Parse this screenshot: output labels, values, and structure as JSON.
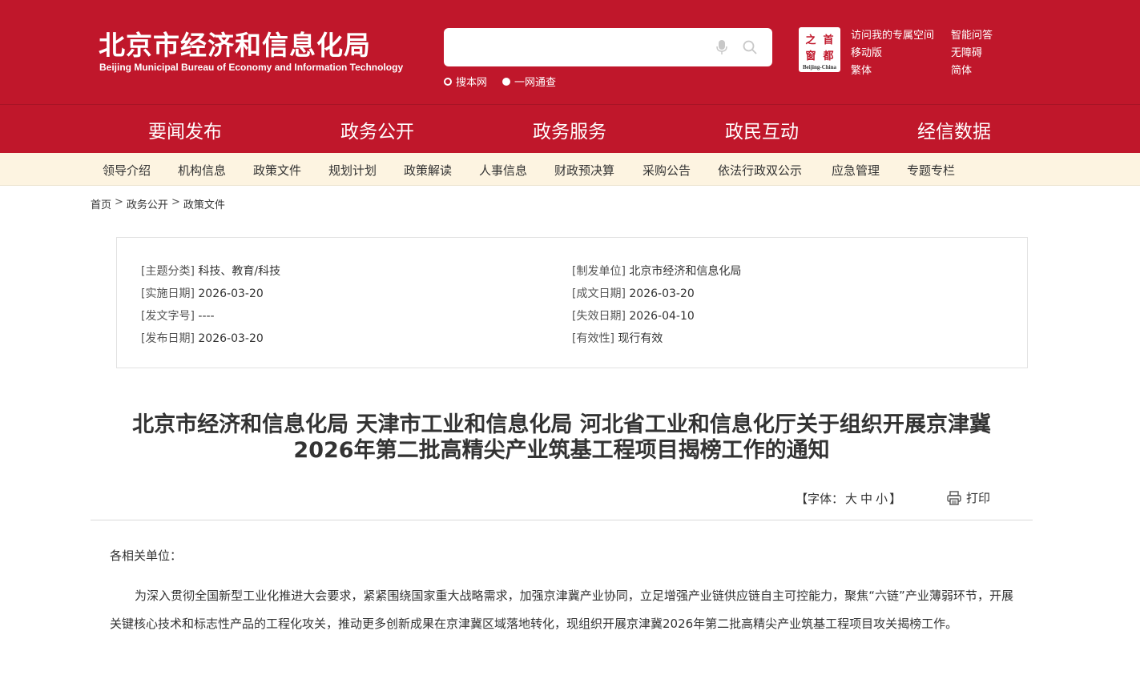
{
  "header": {
    "title_cn": "北京市经济和信息化局",
    "title_en": "Beijing Municipal Bureau of Economy and Information Technology",
    "search": {
      "placeholder": "",
      "scopes": [
        "搜本网",
        "一网通查"
      ],
      "selected_scope": "搜本网"
    },
    "badge": {
      "chars": [
        "之",
        "首",
        "窗",
        "都"
      ],
      "caption": "Beijing-China"
    },
    "links": {
      "space": "访问我的专属空间",
      "qa": "智能问答",
      "mobile": "移动版",
      "accessible": "无障碍",
      "traditional": "繁体",
      "simplified": "简体"
    },
    "colors": {
      "brand_red": "#c0172b",
      "subnav_bg": "#fdf4e1"
    }
  },
  "main_nav": {
    "items": [
      "要闻发布",
      "政务公开",
      "政务服务",
      "政民互动",
      "经信数据"
    ],
    "active": "政务公开"
  },
  "sub_nav": {
    "items": [
      "领导介绍",
      "机构信息",
      "政策文件",
      "规划计划",
      "政策解读",
      "人事信息",
      "财政预决算",
      "采购公告",
      "依法行政双公示",
      "应急管理",
      "专题专栏"
    ]
  },
  "breadcrumb": [
    "首页",
    "政务公开",
    "政策文件"
  ],
  "meta": {
    "topic_label": "[主题分类]",
    "topic": "科技、教育/科技",
    "issuer_label": "[制发单位]",
    "issuer": "北京市经济和信息化局",
    "effective_label": "[实施日期]",
    "effective": "2026-03-20",
    "created_label": "[成文日期]",
    "created": "2026-03-20",
    "docno_label": "[发文字号]",
    "docno": "----",
    "expire_label": "[失效日期]",
    "expire": "2026-04-10",
    "published_label": "[发布日期]",
    "published": "2026-03-20",
    "validity_label": "[有效性]",
    "validity": "现行有效"
  },
  "document": {
    "title_line1": "北京市经济和信息化局 天津市工业和信息化局 河北省工业和信息化厅关于组织开展京津冀",
    "title_line2": "2026年第二批高精尖产业筑基工程项目揭榜工作的通知",
    "font_tool_prefix": "【字体：",
    "font_large": "大",
    "font_medium": "中",
    "font_small": "小",
    "font_tool_suffix": "】",
    "print_label": "打印",
    "salutation": "各相关单位：",
    "paragraph1": "为深入贯彻全国新型工业化推进大会要求，紧紧围绕国家重大战略需求，加强京津冀产业协同，立足增强产业链供应链自主可控能力，聚焦“六链”产业薄弱环节，开展关键核心技术和标志性产品的工程化攻关，推动更多创新成果在京津冀区域落地转化，现组织开展京津冀2026年第二批高精尖产业筑基工程项目攻关揭榜工作。"
  }
}
